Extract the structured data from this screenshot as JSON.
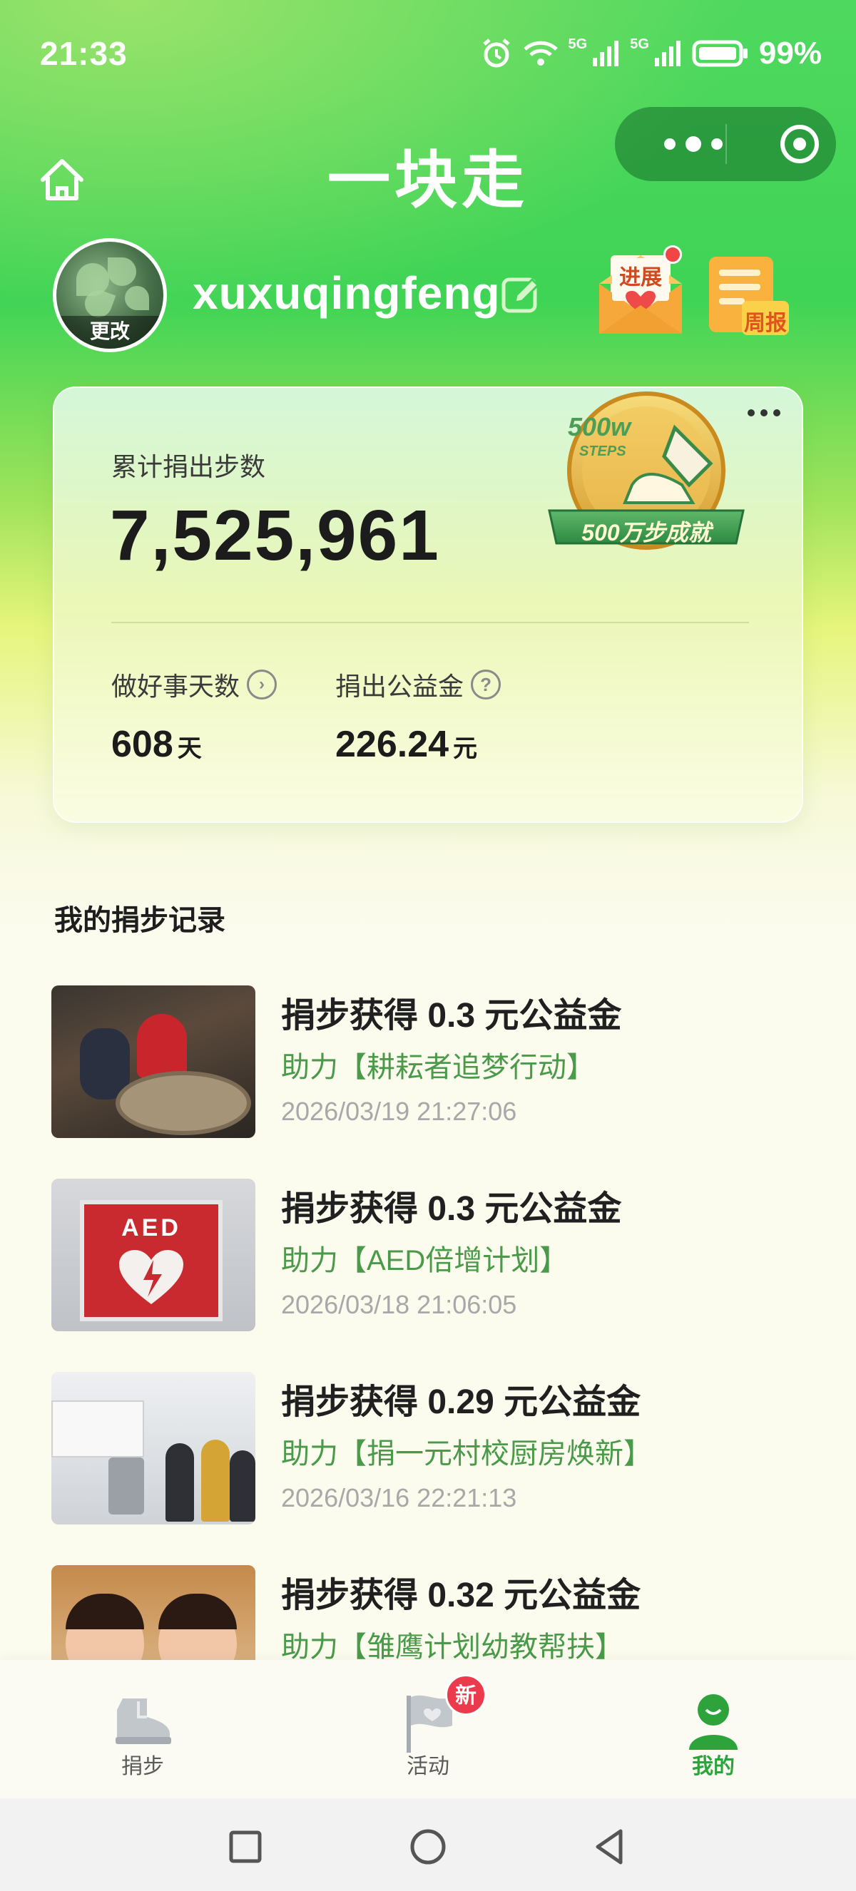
{
  "status_bar": {
    "time": "21:33",
    "network_1": "5G",
    "network_2": "5G",
    "battery": "99%"
  },
  "header": {
    "title": "一块走",
    "home_icon": "home-icon",
    "more_icon": "more-dots-icon",
    "close_icon": "target-circle-icon"
  },
  "profile": {
    "username": "xuxuqingfeng",
    "avatar_change_label": "更改",
    "progress_label": "进展",
    "weekly_label": "周报"
  },
  "summary": {
    "total_label": "累计捐出步数",
    "total_steps": "7,525,961",
    "badge_top": "500w",
    "badge_sub": "STEPS",
    "badge_caption": "500万步成就",
    "days_label": "做好事天数",
    "days_value": "608",
    "days_unit": "天",
    "fund_label": "捐出公益金",
    "fund_value": "226.24",
    "fund_unit": "元"
  },
  "records": {
    "section_title": "我的捐步记录",
    "items": [
      {
        "title": "捐步获得 0.3 元公益金",
        "project": "助力【耕耘者追梦行动】",
        "time": "2026/03/19 21:27:06"
      },
      {
        "title": "捐步获得 0.3 元公益金",
        "project": "助力【AED倍增计划】",
        "time": "2026/03/18 21:06:05"
      },
      {
        "title": "捐步获得 0.29 元公益金",
        "project": "助力【捐一元村校厨房焕新】",
        "time": "2026/03/16 22:21:13"
      },
      {
        "title": "捐步获得 0.32 元公益金",
        "project": "助力【雏鹰计划幼教帮扶】",
        "time": ""
      }
    ]
  },
  "thumb_text": {
    "aed": "AED"
  },
  "tabbar": {
    "tabs": [
      {
        "label": "捐步",
        "icon": "shoe-icon"
      },
      {
        "label": "活动",
        "icon": "flag-icon",
        "badge": "新"
      },
      {
        "label": "我的",
        "icon": "person-icon"
      }
    ]
  },
  "colors": {
    "brand_green": "#3fd455",
    "active_tab": "#2ea33b",
    "badge_red": "#ea3a4c"
  }
}
